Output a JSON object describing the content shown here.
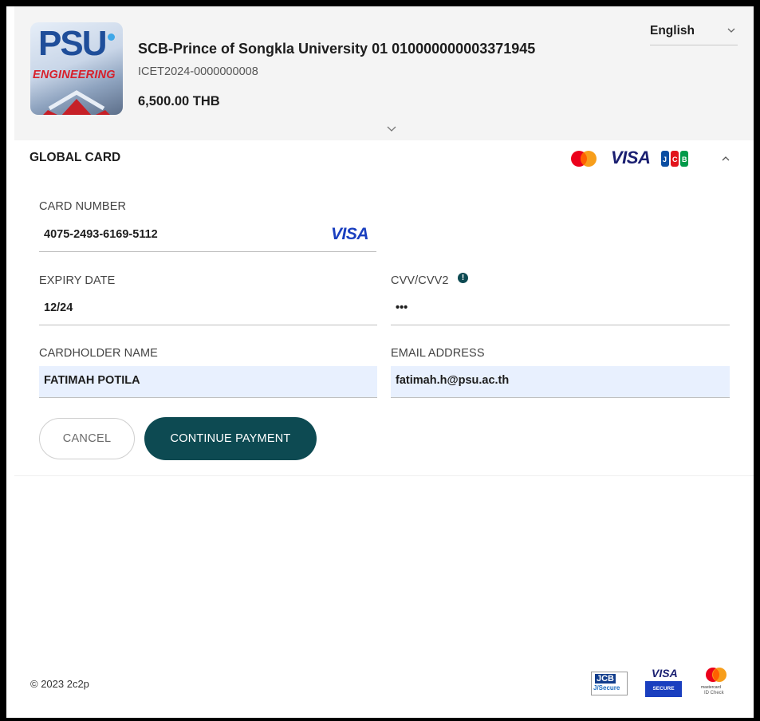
{
  "header": {
    "merchant": "SCB-Prince of Songkla University 01 010000000003371945",
    "invoice": "ICET2024-0000000008",
    "amount": "6,500.00 THB",
    "language": "English",
    "logo": {
      "psu": "PSU",
      "subtitle": "ENGINEERING"
    }
  },
  "section": {
    "title": "GLOBAL CARD",
    "brands": [
      "mastercard",
      "VISA",
      "JCB"
    ]
  },
  "form": {
    "card_number": {
      "label": "CARD NUMBER",
      "value": "4075-2493-6169-5112",
      "brand": "VISA"
    },
    "expiry": {
      "label": "EXPIRY DATE",
      "value": "12/24"
    },
    "cvv": {
      "label": "CVV/CVV2",
      "value": "•••"
    },
    "cardholder": {
      "label": "CARDHOLDER NAME",
      "value": "FATIMAH POTILA"
    },
    "email": {
      "label": "EMAIL ADDRESS",
      "value": "fatimah.h@psu.ac.th"
    }
  },
  "buttons": {
    "cancel": "CANCEL",
    "continue": "CONTINUE PAYMENT"
  },
  "footer": {
    "copyright": "© 2023 2c2p",
    "badges": {
      "jcb_top": "JCB",
      "jcb_bottom": "J/Secure",
      "visa_top": "VISA",
      "visa_bottom": "SECURE",
      "mc_top": "mastercard",
      "mc_bottom": "ID Check"
    }
  },
  "colors": {
    "primary": "#0d4a52",
    "autofill": "#e8f0fe",
    "visa_blue": "#1a1f71"
  }
}
